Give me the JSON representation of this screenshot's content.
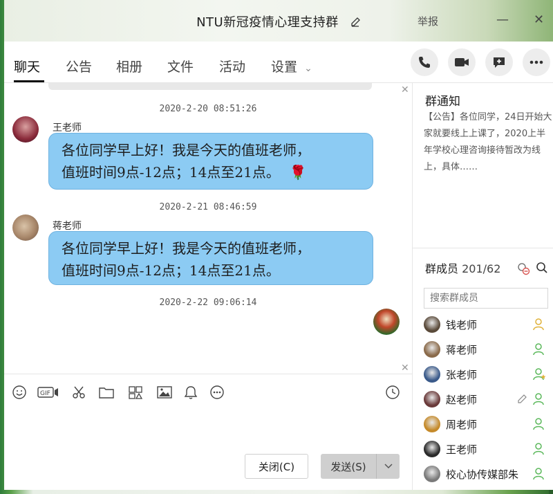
{
  "window": {
    "title": "NTU新冠疫情心理支持群",
    "report_label": "举报",
    "minimize": "—",
    "close": "✕"
  },
  "tabs": [
    {
      "label": "聊天",
      "active": true
    },
    {
      "label": "公告"
    },
    {
      "label": "相册"
    },
    {
      "label": "文件"
    },
    {
      "label": "活动"
    },
    {
      "label": "设置",
      "chevron": "⌄"
    }
  ],
  "header_actions": [
    "phone-icon",
    "video-icon",
    "add-chat-icon",
    "more-icon"
  ],
  "chat": {
    "collapse_glyph": "✕",
    "expand_glyph": "✕",
    "messages": [
      {
        "timestamp": "2020-2-20  08:51:26",
        "sender": "王老师",
        "lines": [
          "各位同学早上好！我是今天的值班老师，",
          "值班时间9点-12点；14点至21点。"
        ],
        "emoji": "🌹"
      },
      {
        "timestamp": "2020-2-21  08:46:59",
        "sender": "蒋老师",
        "lines": [
          "各位同学早上好！我是今天的值班老师，",
          "值班时间9点-12点；14点至21点。"
        ]
      },
      {
        "timestamp": "2020-2-22  09:06:14"
      }
    ]
  },
  "toolbar": {
    "icons": [
      "emoji-icon",
      "gif-icon",
      "screenshot-scissors-icon",
      "folder-icon",
      "multi-image-icon",
      "image-icon",
      "bell-icon",
      "more-circle-icon",
      "history-clock-icon"
    ]
  },
  "buttons": {
    "close_label": "关闭(C)",
    "send_label": "发送(S)"
  },
  "sidebar": {
    "notice_title": "群通知",
    "notice_text": "【公告】各位同学，24日开始大家就要线上上课了，2020上半年学校心理咨询接待暂改为线上，具体……",
    "members_title": "群成员",
    "members_count": "201/62",
    "search_placeholder": "搜索群成员",
    "members": [
      {
        "name": "钱老师",
        "role": "admin",
        "avatar_color": "#5a4a3a"
      },
      {
        "name": "蒋老师",
        "role": "member",
        "avatar_color": "#8a6a4a"
      },
      {
        "name": "张老师",
        "role": "owner",
        "avatar_color": "#3a5a8a"
      },
      {
        "name": "赵老师",
        "role": "member",
        "avatar_color": "#6a3a3a",
        "editable": true
      },
      {
        "name": "周老师",
        "role": "member",
        "avatar_color": "#c58a2a"
      },
      {
        "name": "王老师",
        "role": "member",
        "avatar_color": "#2a2a2a"
      },
      {
        "name": "校心协传媒部朱",
        "role": "member",
        "avatar_color": "#7a7a7a"
      }
    ]
  },
  "colors": {
    "bubble": "#8ccbf3",
    "bubble_border": "#6fb2e0",
    "admin_icon": "#e0b23a",
    "member_icon": "#5bb85b"
  }
}
